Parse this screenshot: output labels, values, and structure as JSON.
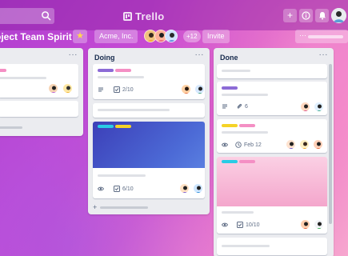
{
  "topbar": {
    "logo_text": "Trello",
    "plus_label": "+",
    "info_label": "i",
    "bell_label": "!"
  },
  "board": {
    "title": "oject Team Spirit",
    "star": "★",
    "workspace": "Acme, Inc.",
    "member_count": "+12",
    "invite": "Invite",
    "more": "···"
  },
  "lists": [
    {
      "title": "",
      "menu": "···"
    },
    {
      "title": "Doing",
      "menu": "···",
      "add_card_symbol": "+"
    },
    {
      "title": "Done",
      "menu": "···"
    }
  ],
  "cards": {
    "doing_1": {
      "checklist": "2/10"
    },
    "doing_2": {
      "checklist": "6/10"
    },
    "done_2": {
      "attachments": "6"
    },
    "done_3": {
      "due": "Feb 12"
    },
    "done_5": {
      "checklist": "10/10"
    }
  },
  "colors": {
    "label_purple": "#8c6bd6",
    "label_pink": "#f48fc4",
    "label_cyan": "#29cce5",
    "label_yellow": "#f5d327",
    "card_cover_blue": "#3f51b5",
    "card_cover_pink": "#f7b3d6"
  }
}
